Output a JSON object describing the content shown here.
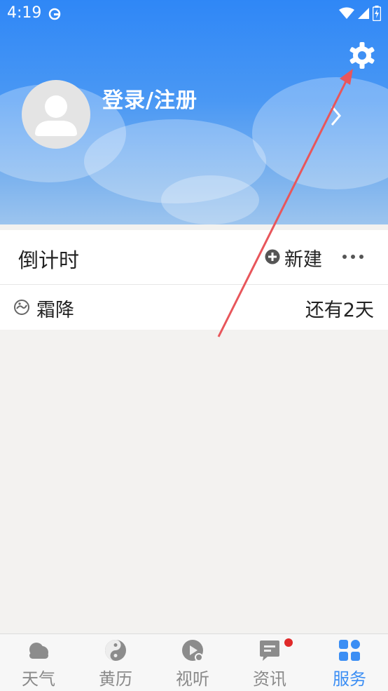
{
  "status_bar": {
    "time": "4:19",
    "icons": [
      "app-notification-icon",
      "wifi-icon",
      "signal-icon",
      "battery-icon"
    ]
  },
  "header": {
    "login_label": "登录/注册",
    "settings_icon": "gear-icon",
    "avatar_icon": "user-avatar-icon"
  },
  "countdown": {
    "title": "倒计时",
    "new_label": "新建",
    "more_icon": "more-icon",
    "events": [
      {
        "name": "霜降",
        "remaining": "还有2天",
        "icon": "solar-term-icon"
      }
    ]
  },
  "bottom_nav": {
    "items": [
      {
        "label": "天气",
        "icon": "cloud-icon",
        "active": false
      },
      {
        "label": "黄历",
        "icon": "yin-yang-icon",
        "active": false
      },
      {
        "label": "视听",
        "icon": "media-play-icon",
        "active": false
      },
      {
        "label": "资讯",
        "icon": "news-icon",
        "active": false,
        "badge": true
      },
      {
        "label": "服务",
        "icon": "services-grid-icon",
        "active": true
      }
    ]
  },
  "colors": {
    "accent": "#3b8ef4",
    "header_top": "#2f87f6",
    "badge": "#e02a2a",
    "annotation_arrow": "#e8565b"
  }
}
